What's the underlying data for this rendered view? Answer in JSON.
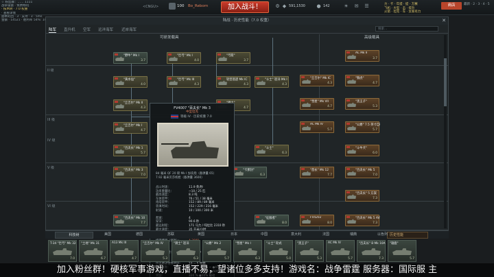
{
  "hud": {
    "left_lines": [
      "☆ 粉丝群：…… 1111",
      "战争雷霆 · 免费畅玩",
      "· 技术树 · 7.0 权重",
      "· 查看详情",
      "副本的回 · 3 · 支持 · 3 · 5ms",
      "金额 · 14521 · 胜利率 54%: 1486"
    ],
    "server": "<CNGU>",
    "level": "100",
    "nick": "Bo_Reborn",
    "battle_label": "加入战斗！",
    "silver": "591,1530",
    "gold": "142",
    "shop": "商店",
    "banner_lines": [
      "力 · 卡 · 年提 · 提 · 方赛",
      "飞机 · 大型 · 击 · 提升",
      "火箭 · 坦克 · 车 · 女家有力"
    ],
    "right": "最新 · 2 · 3 · 4 · 5"
  },
  "window": {
    "title": "陆战 · 历史性能（7.0 权重）",
    "tabs": [
      "陆军",
      "直升机",
      "空军",
      "远洋海军",
      "近岸海军"
    ],
    "search_placeholder": "搜索…",
    "section_research": "可研发载具",
    "section_premium": "高级载具",
    "ranks": [
      "II 级",
      "III 级",
      "IV 级",
      "V 级",
      "VI 级"
    ]
  },
  "nodes": [
    {
      "name": "\"野牛\" Mk I",
      "br": "3.7"
    },
    {
      "name": "\"巨弓\" Mk I",
      "br": "4.0"
    },
    {
      "name": "\"弓箭\"",
      "br": "3.7"
    },
    {
      "name": "AC Mk II",
      "br": "3.7"
    },
    {
      "name": "\"黄水仙\"",
      "br": "4.0"
    },
    {
      "name": "\"巨弓\" Mk III",
      "br": "4.3"
    },
    {
      "name": "轻型巡逻 Mk IC",
      "br": "4.3"
    },
    {
      "name": "\"斗士\" 巡洋 Mk I",
      "br": "4.3"
    },
    {
      "name": "\"丘吉尔\" Mk IC",
      "br": "4.3"
    },
    {
      "name": "\"狼虎\"",
      "br": "4.7"
    },
    {
      "name": "\"丘吉尔\" Mk II",
      "br": "4.3"
    },
    {
      "name": "\"骑士\"",
      "br": "4.7"
    },
    {
      "name": "\"彗星\" Mk VII",
      "br": "4.7"
    },
    {
      "name": "\"丘吉尔\" Mk I",
      "br": "4.7"
    },
    {
      "name": "\"黑王子\"",
      "br": "5.3"
    },
    {
      "name": "AC Mk IV",
      "br": "5.7"
    },
    {
      "name": "\"云\" Mk I",
      "br": "6.3"
    },
    {
      "name": "\"公爵\" 7.5 英寸自行榴",
      "br": "5.7"
    },
    {
      "name": "\"百夫长\" Mk 1",
      "br": "5.7"
    },
    {
      "name": "\"斗士\"",
      "br": "6.3"
    },
    {
      "name": "\"斗牛犬\"",
      "br": "6.0"
    },
    {
      "name": "\"百夫长\" Mk 3",
      "br": "7.0"
    },
    {
      "name": "FV4007 \"百夫长\"",
      "br": "6.7"
    },
    {
      "name": "\"卡那封\"",
      "br": "6.3"
    },
    {
      "name": "\"酋长\" Mk 12",
      "br": "7.7"
    },
    {
      "name": "\"百夫长\" Mk 5",
      "br": "7.0"
    },
    {
      "name": "\"百夫长\" 5 方案",
      "br": "7.3"
    },
    {
      "name": "\"百夫长\" Mk 10",
      "br": "7.7"
    },
    {
      "name": "\"百夫长\" Mk 5 AVRE",
      "br": "7.3"
    },
    {
      "name": "\"征服者\"",
      "br": "8.0"
    },
    {
      "name": "FV4202",
      "br": "8.0"
    }
  ],
  "tooltip": {
    "title": "FV4007 \"百夫长\" Mk 3",
    "subtitle": "中型坦克",
    "rank": "等级 IV · 历史权重 7.0",
    "weapons": [
      "84 毫米 QF 20 磅 Mk I 加农炮（备弹量 65）",
      "7.92 毫米贝莎机枪（备弹量 3600）"
    ],
    "rows": [
      {
        "k": "战斗时速：",
        "v": "11.9 英/秒"
      },
      {
        "k": "功率重量比：",
        "v": "~10 / 25 匹"
      },
      {
        "k": "最高速度：",
        "v": "8.3 吨"
      },
      {
        "k": "车体装甲：",
        "v": "76 / 51 / 38 毫米"
      },
      {
        "k": "炮塔装甲：",
        "v": "152 / 89 / 89 毫米"
      },
      {
        "k": "装填时间：",
        "v": "152 / 229 / 216 毫米"
      },
      {
        "k": "射速：",
        "v": "10 / 100 / 300 米"
      },
      {
        "k": "",
        "v": ""
      },
      {
        "k": "爬坡：",
        "v": "4"
      },
      {
        "k": "穿深：",
        "v": "90.6 秒"
      },
      {
        "k": "最远射程：",
        "v": "171 马力 / 吨位比 2310 秒"
      },
      {
        "k": "最大速度：",
        "v": "35 千米/小时"
      },
      {
        "k": "火炮俯仰：",
        "v": "119 %"
      },
      {
        "k": "",
        "v": ""
      },
      {
        "k": "修理费用（修复）：",
        "v": "4,3000",
        "red": true
      },
      {
        "k": "",
        "v": ""
      },
      {
        "k": "银狮奖励：",
        "v": "26"
      },
      {
        "k": "研究点奖励：",
        "v": "10,0000"
      },
      {
        "k": "进攻奖励：",
        "v": "430"
      },
      {
        "k": "防御奖励：",
        "v": "0"
      },
      {
        "k": "历史模式银狮奖励：",
        "v": "10 ~ 5 银狮"
      },
      {
        "k": "研究点数：",
        "v": "1.84 + 100% ~ ●47%"
      },
      {
        "k": "银狮收益：",
        "v": "1.5 + 100% ~ ●50%"
      },
      {
        "k": "奖励：",
        "v": "320 % ●50% 被动"
      }
    ]
  },
  "bottom": {
    "tree_button": "科技树",
    "countries": [
      "美国",
      "德国",
      "苏联",
      "英国",
      "日本",
      "中国",
      "意大利",
      "法国",
      "瑞典",
      "以色列"
    ],
    "history_select": "历史性能",
    "slots": [
      {
        "name": "T-34 \"巨弓\" Mk 32",
        "br": "7.0"
      },
      {
        "name": "\"土地\" Mk 31",
        "br": "6.7"
      },
      {
        "name": "A13 Mk III",
        "br": "4.7"
      },
      {
        "name": "\"丘吉尔\" Mk IV",
        "br": "5.3"
      },
      {
        "name": "\"骑士\" 巡洋",
        "br": "6.3"
      },
      {
        "name": "\"公爵\" Mk 2",
        "br": "5.7"
      },
      {
        "name": "\"彗星\" Mk I",
        "br": "6.3"
      },
      {
        "name": "\"斗士\" 轮式",
        "br": "5.0"
      },
      {
        "name": "\"黑王子\"",
        "br": "5.3"
      },
      {
        "name": "AC Mk IV",
        "br": "5.7"
      },
      {
        "name": "\"百夫长\" B Mk 10A",
        "br": "7.3"
      },
      {
        "name": "\"雄鹿\"",
        "br": "5.7"
      }
    ]
  },
  "subtitle": "加入粉丝群！硬核军事游戏，直播不易，望诸位多多支持！游戏名：战争雷霆 服务器：国际服 主"
}
